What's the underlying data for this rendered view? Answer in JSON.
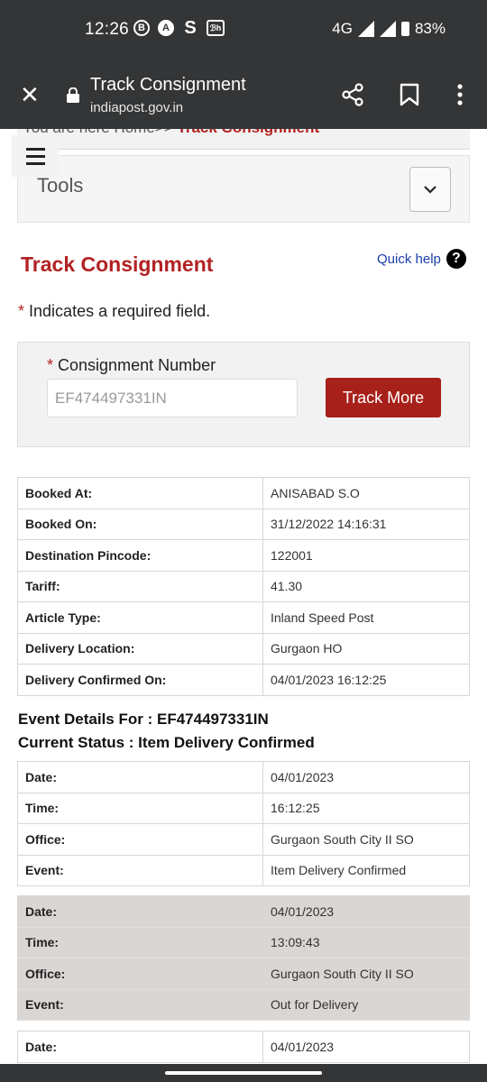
{
  "status_bar": {
    "time": "12:26",
    "app_icons": [
      "B",
      "A",
      "S",
      "ℬh"
    ],
    "network": "4G",
    "battery": "83%"
  },
  "browser": {
    "page_title": "Track Consignment",
    "url": "indiapost.gov.in"
  },
  "breadcrumb": {
    "prefix": "You are here Home>> ",
    "current": "Track Consignment"
  },
  "tools": {
    "label": "Tools"
  },
  "heading": "Track Consignment",
  "quick_help": "Quick help",
  "required_note": "Indicates a required field.",
  "form": {
    "label": "Consignment Number",
    "value": "EF474497331IN",
    "button": "Track More"
  },
  "booking_details": [
    {
      "label": "Booked At:",
      "value": "ANISABAD S.O"
    },
    {
      "label": "Booked On:",
      "value": "31/12/2022 14:16:31"
    },
    {
      "label": "Destination Pincode:",
      "value": "122001"
    },
    {
      "label": "Tariff:",
      "value": "41.30"
    },
    {
      "label": "Article Type:",
      "value": "Inland Speed Post"
    },
    {
      "label": "Delivery Location:",
      "value": "Gurgaon HO"
    },
    {
      "label": "Delivery Confirmed On:",
      "value": "04/01/2023 16:12:25"
    }
  ],
  "event_details_title": "Event Details For : EF474497331IN",
  "current_status": "Current Status : Item Delivery Confirmed",
  "events": [
    {
      "date_label": "Date:",
      "date": "04/01/2023",
      "time_label": "Time:",
      "time": "16:12:25",
      "office_label": "Office:",
      "office": "Gurgaon South City II SO",
      "event_label": "Event:",
      "event": "Item Delivery Confirmed"
    },
    {
      "date_label": "Date:",
      "date": "04/01/2023",
      "time_label": "Time:",
      "time": "13:09:43",
      "office_label": "Office:",
      "office": "Gurgaon South City II SO",
      "event_label": "Event:",
      "event": "Out for Delivery"
    },
    {
      "date_label": "Date:",
      "date": "04/01/2023"
    }
  ]
}
